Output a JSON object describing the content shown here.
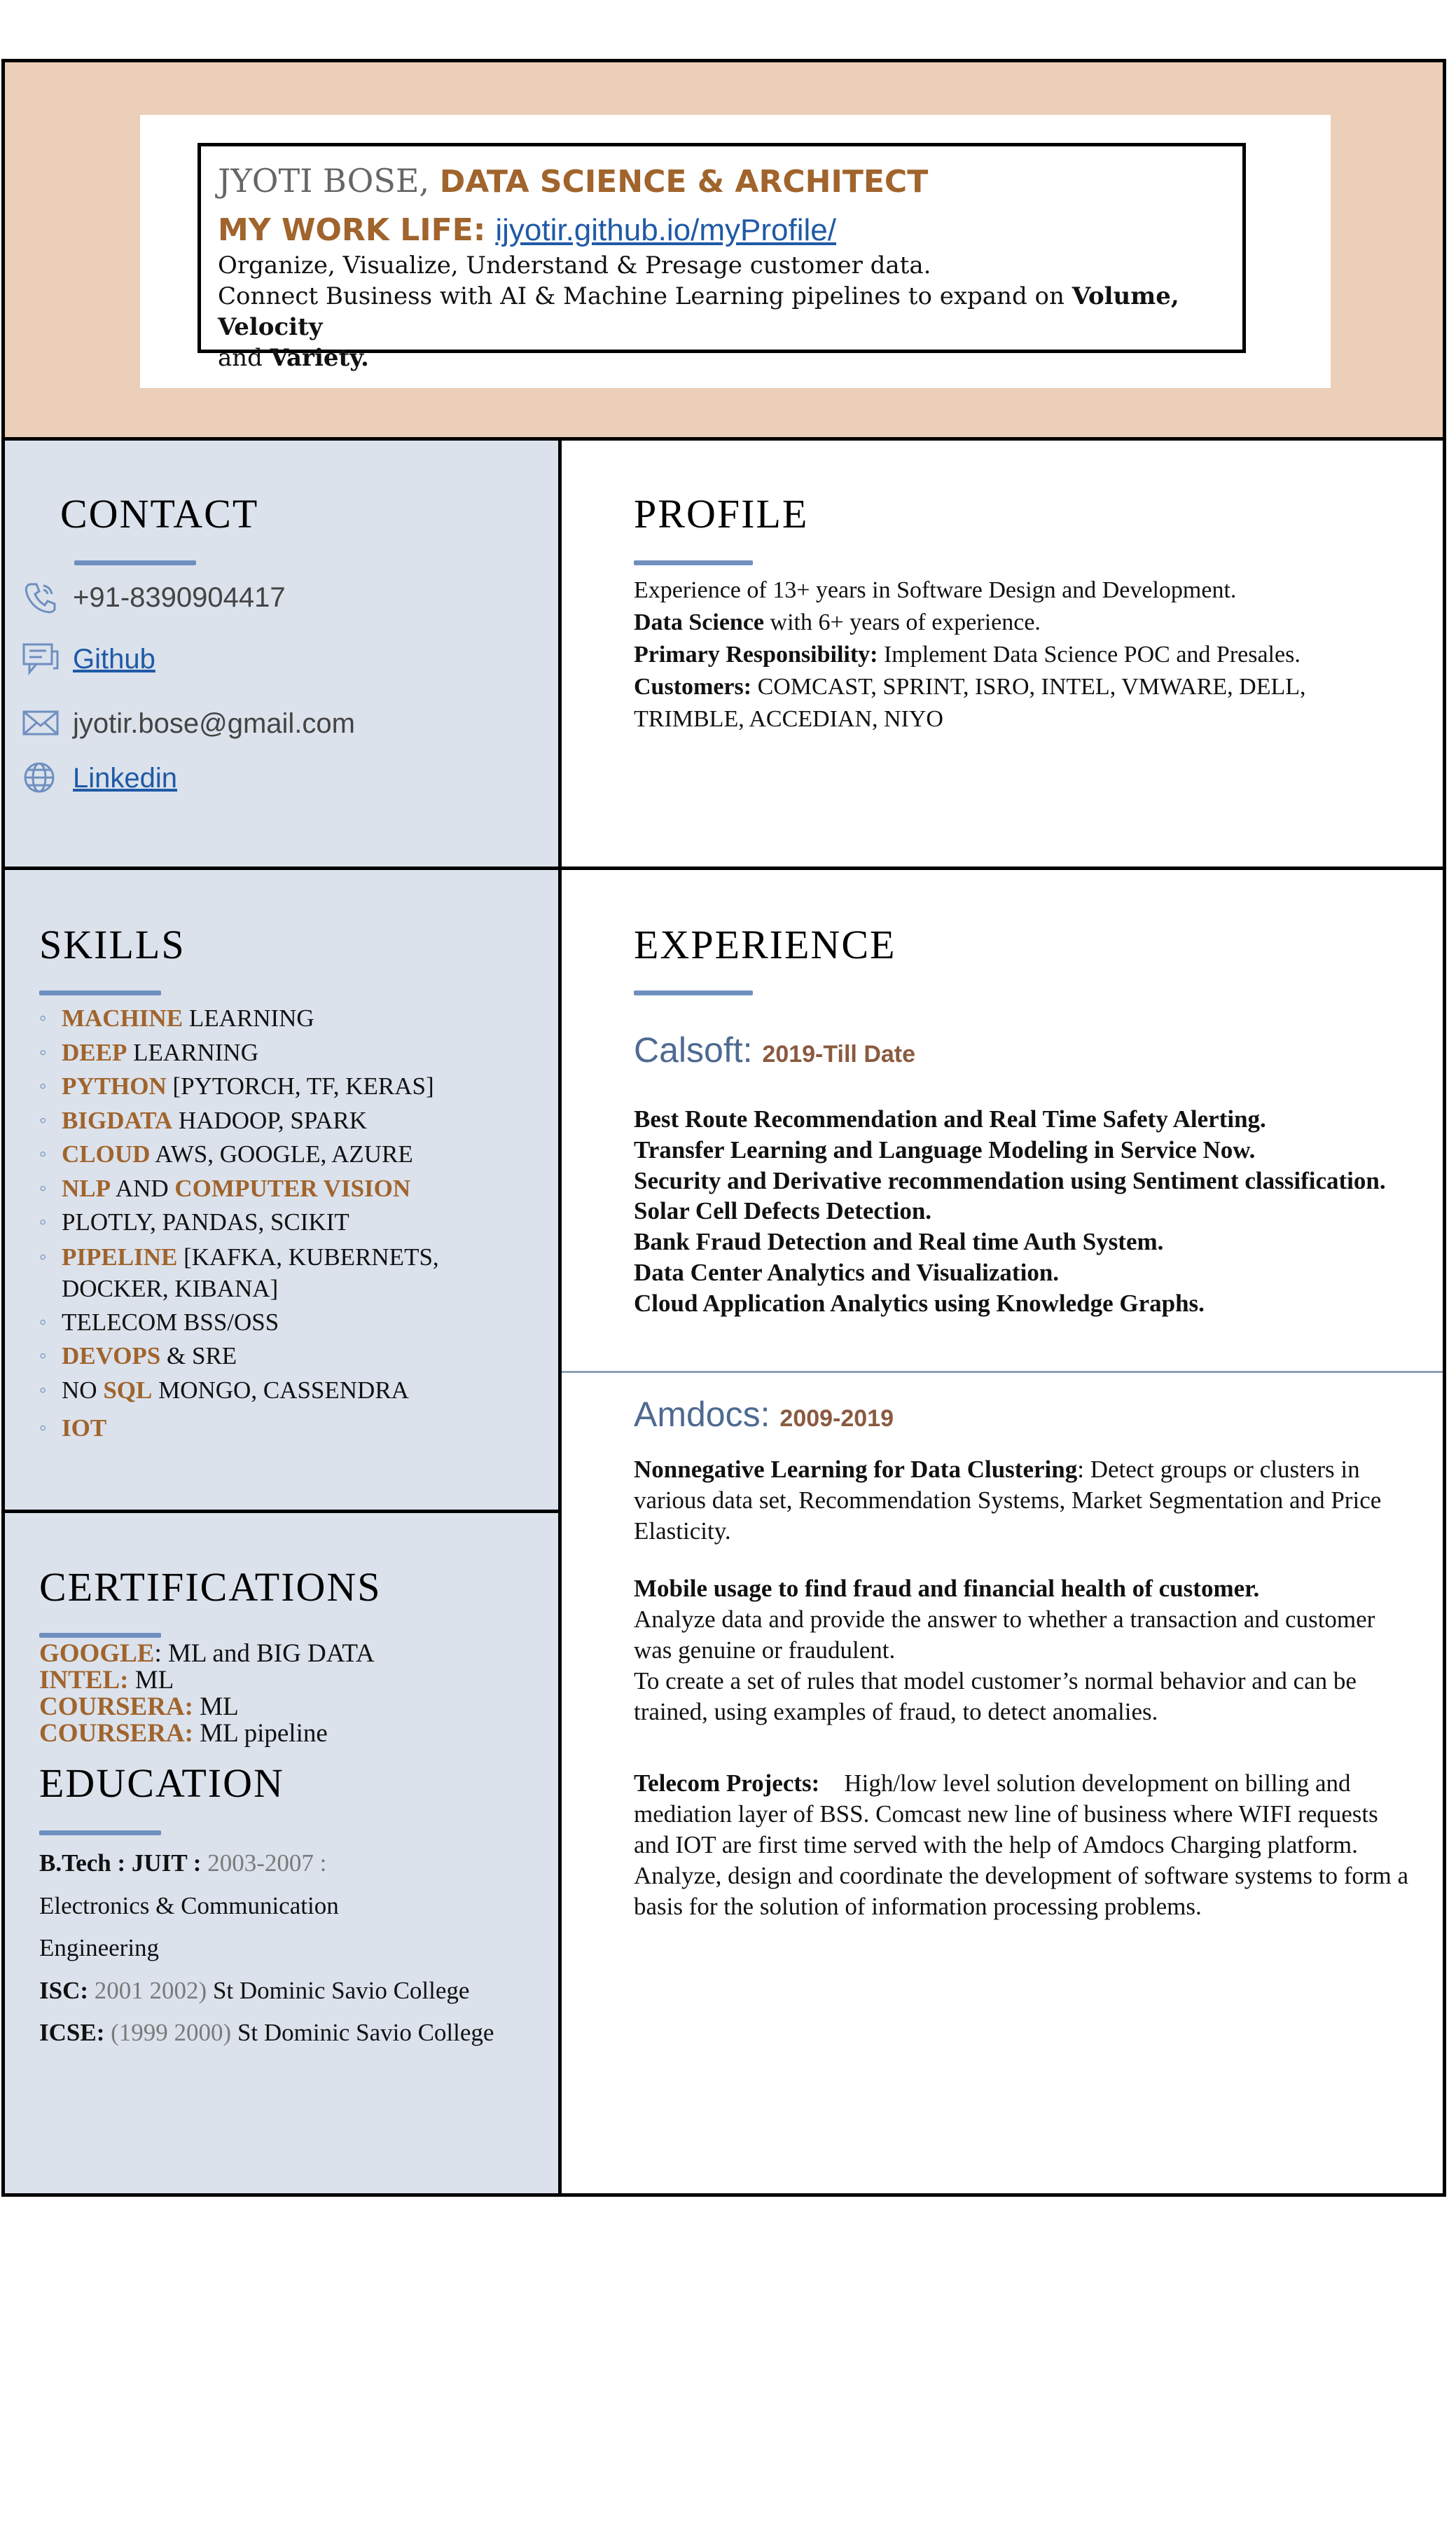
{
  "header": {
    "name": "JYOTI BOSE,",
    "role": "DATA SCIENCE & ARCHITECT",
    "worklife_label": "MY WORK LIFE:",
    "worklife_link": "ijyotir.github.io/myProfile/",
    "tagline_1": "Organize, Visualize, Understand & Presage customer data.",
    "tagline_2_prefix": "Connect Business with AI & Machine Learning pipelines to expand on ",
    "tagline_2_bold": "Volume, Velocity",
    "tagline_3_prefix": "and ",
    "tagline_3_bold": "Variety."
  },
  "contact": {
    "title": "CONTACT",
    "phone": "+91-8390904417",
    "github": "Github",
    "email": "jyotir.bose@gmail.com",
    "linkedin": "Linkedin"
  },
  "profile": {
    "title": "PROFILE",
    "line_1": "Experience of 13+ years in Software Design and Development.",
    "ds_label": "Data Science",
    "ds_text": " with 6+ years of experience.",
    "resp_label": "Primary Responsibility:",
    "resp_text": " Implement Data Science POC and Presales.",
    "cust_label": "Customers:",
    "cust_text": " COMCAST, SPRINT, ISRO, INTEL, VMWARE, DELL, TRIMBLE, ACCEDIAN, NIYO"
  },
  "skills": {
    "title": "SKILLS",
    "items": [
      {
        "hl": "MACHINE",
        "rest": " LEARNING"
      },
      {
        "hl": "DEEP",
        "rest": " LEARNING"
      },
      {
        "hl": "PYTHON",
        "rest": " [PYTORCH, TF, KERAS]"
      },
      {
        "hl": "BIGDATA",
        "rest": " HADOOP, SPARK"
      },
      {
        "hl": "CLOUD",
        "rest": " AWS, GOOGLE, AZURE"
      },
      {
        "hl": "NLP",
        "rest": " AND ",
        "hl2": "COMPUTER VISION"
      },
      {
        "hl": "",
        "rest": "PLOTLY, PANDAS, SCIKIT"
      },
      {
        "hl": "PIPELINE",
        "rest": " [KAFKA, KUBERNETS, DOCKER, KIBANA]"
      },
      {
        "hl": "",
        "rest": "TELECOM BSS/OSS"
      },
      {
        "hl": "DEVOPS",
        "rest": " & SRE"
      },
      {
        "pre": "NO ",
        "hl": "SQL",
        "rest": " MONGO, CASSENDRA"
      },
      {
        "hl": "IOT",
        "rest": ""
      }
    ]
  },
  "certifications": {
    "title": "CERTIFICATIONS",
    "items": [
      {
        "org": "GOOGLE",
        "text": ": ML and BIG DATA"
      },
      {
        "org": "INTEL:",
        "text": "  ML"
      },
      {
        "org": "COURSERA:",
        "text": "  ML"
      },
      {
        "org": "COURSERA:",
        "text": " ML pipeline"
      }
    ]
  },
  "education": {
    "title": "EDUCATION",
    "btech_label": "B.Tech : JUIT :",
    "btech_years": " 2003-2007 :",
    "btech_text": "Electronics & Communication Engineering",
    "isc_label": "ISC:",
    "isc_years": " 2001 2002)",
    "isc_text": " St Dominic Savio College",
    "icse_label": "ICSE:",
    "icse_years": " (1999 2000)",
    "icse_text": " St Dominic Savio College"
  },
  "experience": {
    "title": "EXPERIENCE",
    "calsoft": {
      "company": "Calsoft:",
      "dates": "2019-Till Date",
      "projects": [
        "Best Route Recommendation and Real Time Safety Alerting.",
        "Transfer Learning and Language Modeling in Service Now.",
        "Security and Derivative recommendation using Sentiment classification.",
        "Solar Cell Defects Detection.",
        "Bank Fraud Detection and Real time Auth System.",
        "Data Center Analytics and Visualization.",
        "Cloud Application Analytics using Knowledge Graphs."
      ]
    },
    "amdocs": {
      "company": "Amdocs:",
      "dates": "2009-2019",
      "nonneg_label": "Nonnegative Learning for Data Clustering",
      "nonneg_text": ": Detect groups or clusters in various data set, Recommendation Systems, Market Segmentation and Price Elasticity.",
      "mobile_label": "Mobile usage to find fraud and financial health of customer.",
      "mobile_text_1": "Analyze data and provide the answer to whether a transaction and customer was genuine or fraudulent.",
      "mobile_text_2": "To create a set of rules that model customer’s normal behavior and can be trained, using examples of fraud, to detect anomalies.",
      "telecom_label": "Telecom Projects:",
      "telecom_text": "    High/low level solution development on billing and mediation layer of BSS. Comcast new line of business where WIFI requests and IOT are first time served with the help of Amdocs Charging platform. Analyze, design and coordinate the development of software systems to form a basis for the solution of information processing problems."
    }
  },
  "colors": {
    "header_band": "#ebcfb8",
    "left_panel": "#dbe2ec",
    "accent_orange": "#a0642c",
    "accent_blue": "#4e6a91",
    "underline": "#6f8fbf",
    "link": "#1f5aa6"
  },
  "icons": [
    "phone-icon",
    "chat-icon",
    "envelope-icon",
    "globe-icon"
  ]
}
